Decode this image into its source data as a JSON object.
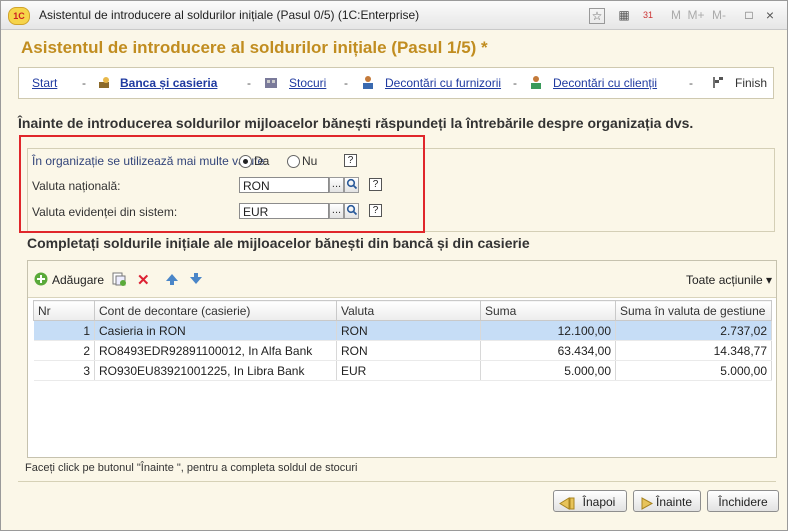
{
  "window": {
    "title": "Asistentul de introducere al soldurilor inițiale (Pasul 0/5)  (1C:Enterprise)",
    "logo": "1C",
    "controls": [
      "☆",
      "▦",
      "31",
      "M",
      "M+",
      "M-",
      "□",
      "×"
    ]
  },
  "heading": "Asistentul de introducere al soldurilor inițiale (Pasul 1/5) *",
  "nav": {
    "start": "Start",
    "sep": "-",
    "bank": "Banca și casieria",
    "stocks": "Stocuri",
    "suppliers": "Decontări cu furnizorii",
    "clients": "Decontări cu clienții",
    "finish": "Finish"
  },
  "intro": "Înainte de introducerea soldurilor mijloacelor bănești răspundeți la întrebările despre organizația dvs.",
  "questions": {
    "multi_label": "În organizație se utilizează mai multe valute:",
    "yes": "Da",
    "no": "Nu",
    "selected": "Da",
    "national_label": "Valuta națională:",
    "national_value": "RON",
    "system_label": "Valuta evidenței din sistem:",
    "system_value": "EUR",
    "help": "?",
    "dots": "...",
    "search_glyph": "🔍"
  },
  "section_title": "Completați soldurile inițiale ale mijloacelor bănești din bancă și din casierie",
  "toolbar": {
    "add": "Adăugare",
    "all_actions": "Toate acțiunile"
  },
  "table": {
    "columns": [
      "Nr",
      "Cont de decontare (casierie)",
      "Valuta",
      "Suma",
      "Suma în valuta de gestiune"
    ],
    "rows": [
      {
        "nr": "1",
        "account": "Casieria in RON",
        "currency": "RON",
        "sum": "12.100,00",
        "sum_mgmt": "2.737,02"
      },
      {
        "nr": "2",
        "account": "RO8493EDR92891100012, In Alfa Bank",
        "currency": "RON",
        "sum": "63.434,00",
        "sum_mgmt": "14.348,77"
      },
      {
        "nr": "3",
        "account": "RO930EU83921001225, In Libra Bank",
        "currency": "EUR",
        "sum": "5.000,00",
        "sum_mgmt": "5.000,00"
      }
    ]
  },
  "footnote": "Faceți click pe butonul \"Înainte \", pentru a completa soldul de stocuri",
  "buttons": {
    "back": "Înapoi",
    "next": "Înainte",
    "close": "Închidere"
  },
  "colors": {
    "heading": "#c18d20",
    "link": "#1f3aa0",
    "highlight_box": "#e0262b",
    "selected_row": "#c6ddf6"
  }
}
